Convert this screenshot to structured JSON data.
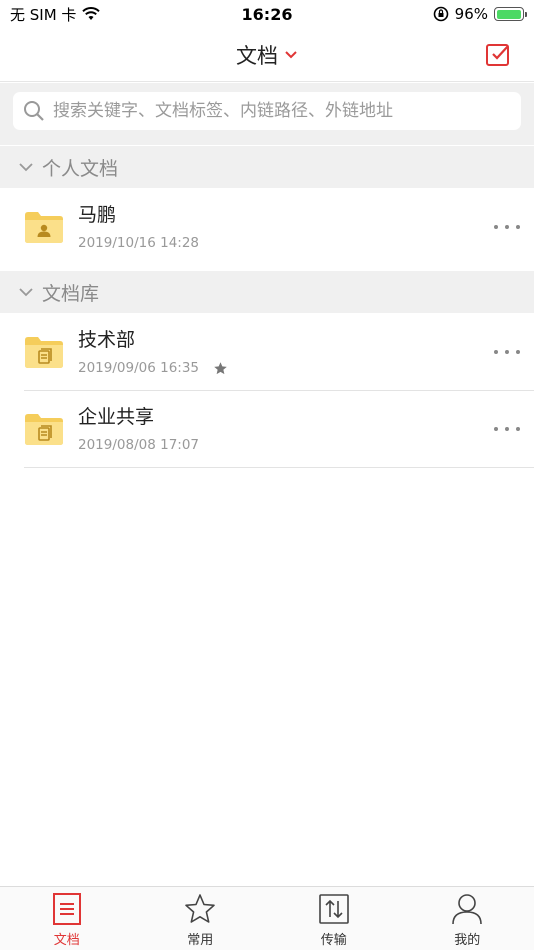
{
  "status_bar": {
    "carrier": "无 SIM 卡",
    "time": "16:26",
    "battery_percent": "96%",
    "battery_level": 0.96
  },
  "nav": {
    "title": "文档",
    "accent": "#e03535"
  },
  "search": {
    "placeholder": "搜索关键字、文档标签、内链路径、外链地址"
  },
  "sections": [
    {
      "title": "个人文档",
      "items": [
        {
          "name": "马鹏",
          "date": "2019/10/16 14:28",
          "icon": "personal-folder-icon",
          "starred": false
        }
      ]
    },
    {
      "title": "文档库",
      "items": [
        {
          "name": "技术部",
          "date": "2019/09/06 16:35",
          "icon": "library-folder-icon",
          "starred": true
        },
        {
          "name": "企业共享",
          "date": "2019/08/08 17:07",
          "icon": "library-folder-icon",
          "starred": false
        }
      ]
    }
  ],
  "tabs": [
    {
      "label": "文档",
      "icon": "document-list-icon",
      "active": true
    },
    {
      "label": "常用",
      "icon": "star-icon",
      "active": false
    },
    {
      "label": "传输",
      "icon": "transfer-icon",
      "active": false
    },
    {
      "label": "我的",
      "icon": "user-icon",
      "active": false
    }
  ]
}
